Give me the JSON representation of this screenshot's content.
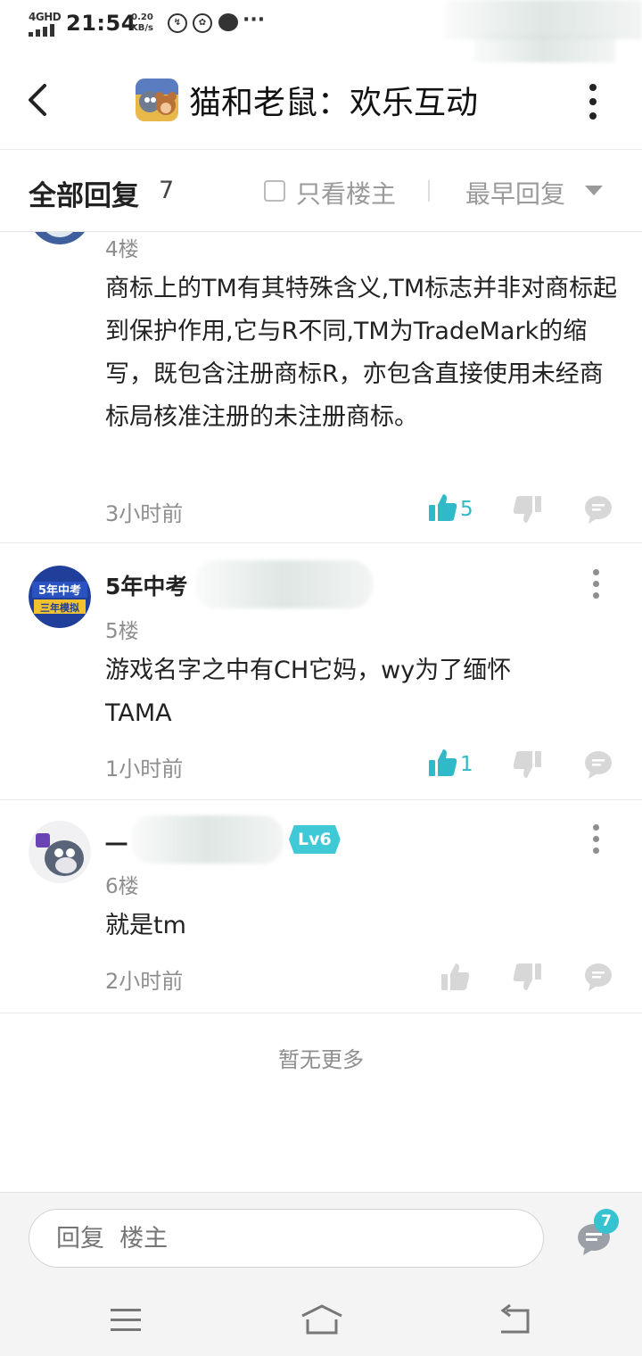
{
  "status_bar": {
    "network": "4GHD",
    "time": "21:54",
    "speed_value": "0.20",
    "speed_unit": "KB/s",
    "icons": [
      "app-icon-1",
      "app-icon-2",
      "chat-icon"
    ],
    "more": "···"
  },
  "header": {
    "title": "猫和老鼠：欢乐互动",
    "icons": [
      "back-icon",
      "game-logo",
      "more-vertical-icon"
    ]
  },
  "filter_bar": {
    "title": "全部回复",
    "count": "7",
    "op_only_label": "只看楼主",
    "sort_label": "最早回复"
  },
  "comments": [
    {
      "floor": "4楼",
      "content": "商标上的TM有其特殊含义,TM标志并非对商标起到保护作用,它与R不同,TM为TradeMark的缩写，既包含注册商标R，亦包含直接使用未经商标局核准注册的未注册商标。",
      "time": "3小时前",
      "likes": "5",
      "liked": true
    },
    {
      "username": "5年中考",
      "floor": "5楼",
      "content": "游戏名字之中有CH它妈，wy为了缅怀TAMA",
      "time": "1小时前",
      "likes": "1",
      "liked": true
    },
    {
      "username": "一",
      "level": "Lv6",
      "floor": "6楼",
      "content": "就是tm",
      "time": "2小时前",
      "likes": "",
      "liked": false
    }
  ],
  "no_more": "暂无更多",
  "reply_bar": {
    "placeholder": "回复  楼主",
    "count": "7"
  },
  "colors": {
    "accent": "#2fb9c9",
    "text_primary": "#222222",
    "text_secondary": "#8e8e8e",
    "icon_inactive": "#d7d7d7",
    "background": "#ffffff"
  }
}
